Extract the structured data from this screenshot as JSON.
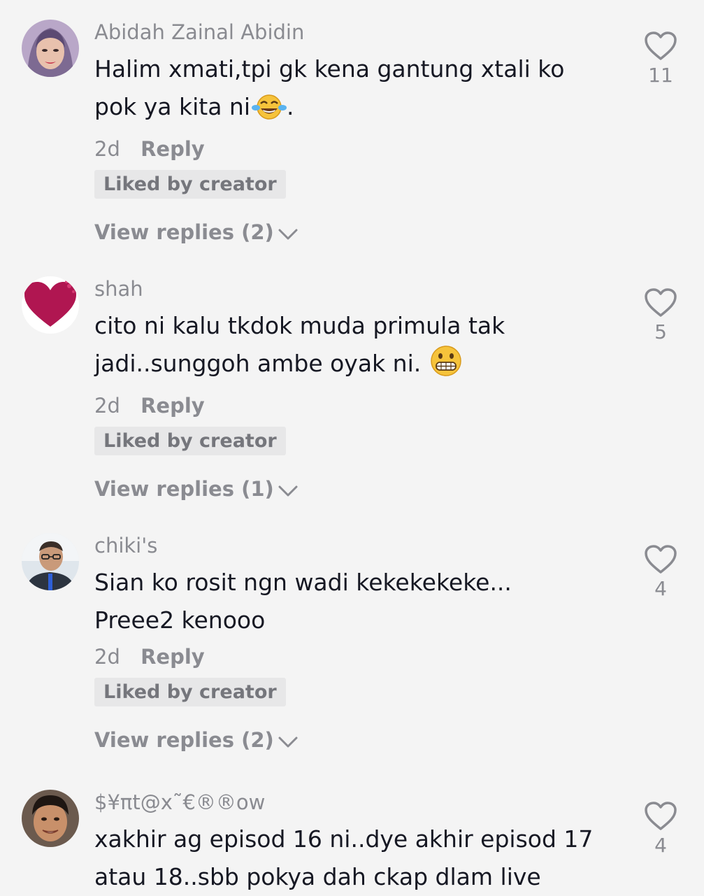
{
  "comments": [
    {
      "username": "Abidah Zainal Abidin",
      "text_line1": "Halim xmati,tpi gk kena gantung xtali ko",
      "text_line2": "pok ya kita ni",
      "text_line2_suffix": ".",
      "emoji": "face-with-tears-of-joy",
      "time": "2d",
      "reply_label": "Reply",
      "badge": "Liked by creator",
      "view_replies": "View replies (2)",
      "likes": "11"
    },
    {
      "username": "shah",
      "text_line1": "cito ni kalu tkdok muda primula tak",
      "text_line2": "jadi..sunggoh ambe oyak ni.",
      "text_line2_suffix": "",
      "emoji": "grimacing-face",
      "time": "2d",
      "reply_label": "Reply",
      "badge": "Liked by creator",
      "view_replies": "View replies (1)",
      "likes": "5"
    },
    {
      "username": "chiki's",
      "text_line1": "Sian ko rosit ngn wadi kekekekeke...",
      "text_line2": "Preee2 kenooo",
      "text_line2_suffix": "",
      "time": "2d",
      "reply_label": "Reply",
      "badge": "Liked by creator",
      "view_replies": "View replies (2)",
      "likes": "4"
    },
    {
      "username": "$¥πt@x˜€®®ow",
      "text_line1": "xakhir ag episod 16 ni..dye akhir episod 17",
      "text_line2": "atau 18..sbb pokya dah ckap dlam live",
      "text_line2_suffix": "",
      "likes": "4"
    }
  ],
  "icons": {
    "like": "heart-outline-icon",
    "expand": "chevron-down-icon"
  },
  "colors": {
    "background": "#f4f4f4",
    "text": "#161823",
    "muted": "#8a8b91",
    "badge_bg": "#e7e7e8"
  }
}
